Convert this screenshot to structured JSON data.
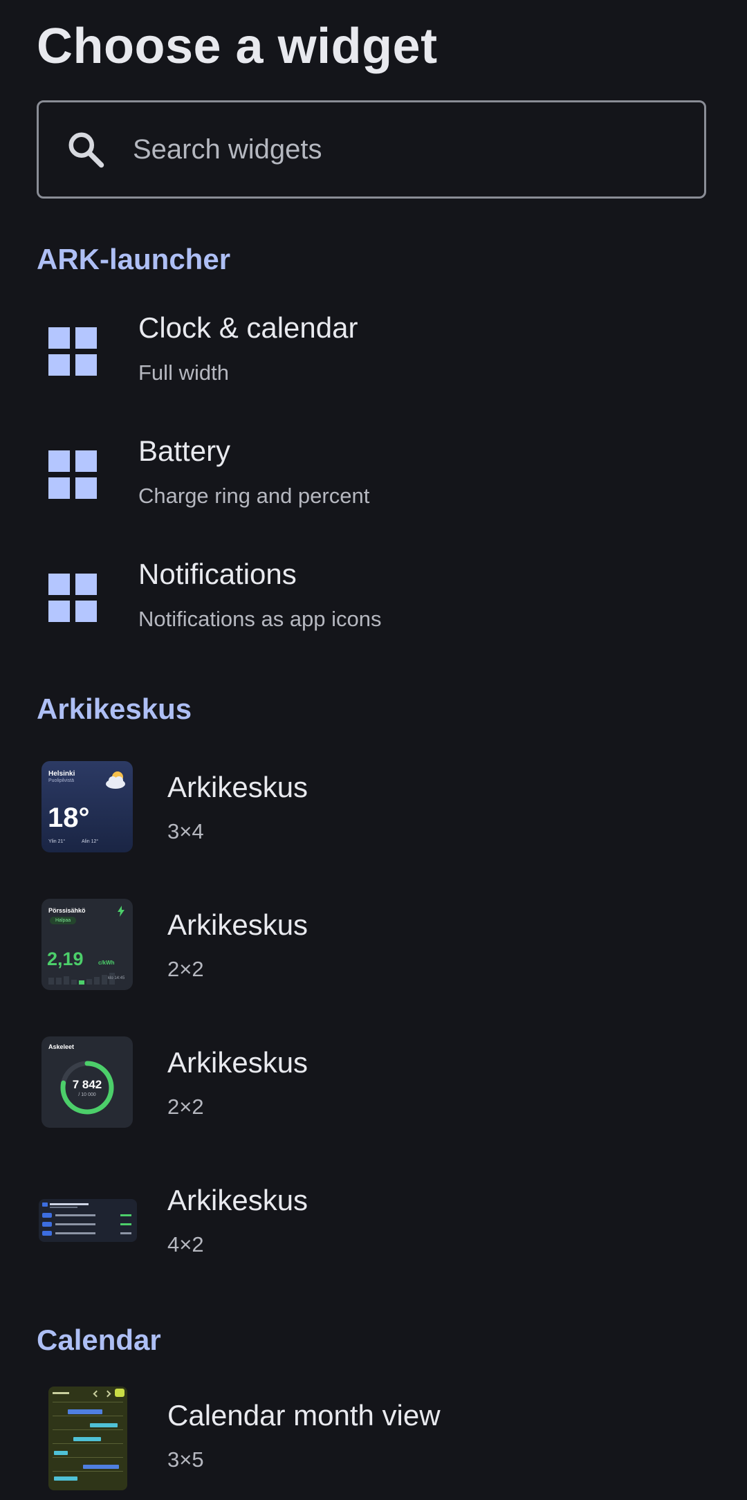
{
  "header": {
    "title": "Choose a widget"
  },
  "search": {
    "placeholder": "Search widgets"
  },
  "sections": [
    {
      "title": "ARK-launcher",
      "items": [
        {
          "name": "Clock & calendar",
          "sub": "Full width"
        },
        {
          "name": "Battery",
          "sub": "Charge ring and percent"
        },
        {
          "name": "Notifications",
          "sub": "Notifications as app icons"
        }
      ]
    },
    {
      "title": "Arkikeskus",
      "items": [
        {
          "name": "Arkikeskus",
          "sub": "3×4"
        },
        {
          "name": "Arkikeskus",
          "sub": "2×2"
        },
        {
          "name": "Arkikeskus",
          "sub": "2×2"
        },
        {
          "name": "Arkikeskus",
          "sub": "4×2"
        }
      ]
    },
    {
      "title": "Calendar",
      "items": [
        {
          "name": "Calendar month view",
          "sub": "3×5"
        }
      ]
    }
  ],
  "previews": {
    "weather": {
      "city": "Helsinki",
      "desc": "Puolipilvistä",
      "temp": "18°",
      "high": "Ylin 21°",
      "low": "Alin 12°"
    },
    "electricity": {
      "title": "Pörssisähkö",
      "badge": "Halpaa",
      "price": "2,19",
      "unit": "c/kWh",
      "time": "klo 14:45"
    },
    "steps": {
      "title": "Askeleet",
      "value": "7 842",
      "goal": "/ 10 000",
      "progress": 0.78
    }
  },
  "colors": {
    "accent": "#aebff5",
    "icon": "#b4c6ff",
    "background": "#14151a",
    "green": "#4ccf6a"
  }
}
